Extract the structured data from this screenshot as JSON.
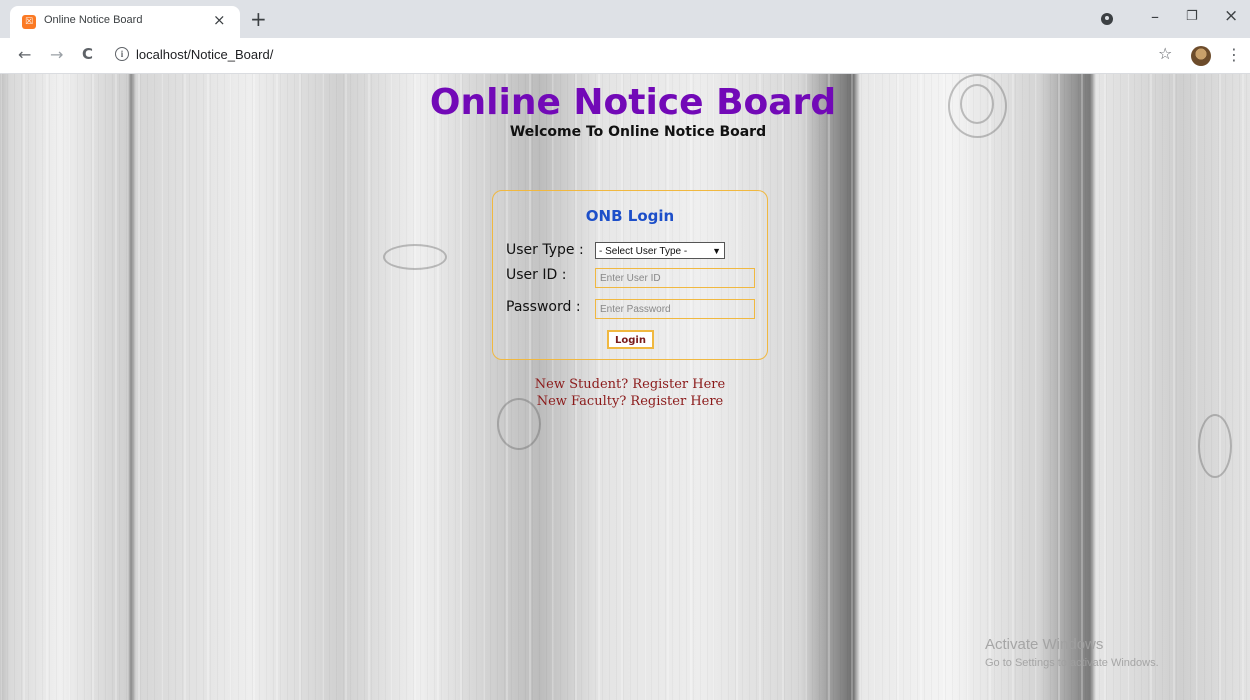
{
  "browser": {
    "tab_title": "Online Notice Board",
    "tab_close": "×",
    "new_tab": "+",
    "url": "localhost/Notice_Board/",
    "minimize": "–",
    "restore": "❐",
    "close": "×",
    "back": "←",
    "forward": "→",
    "reload": "C",
    "info": "i",
    "star": "☆",
    "menu": "⋮"
  },
  "page": {
    "title": "Online Notice Board",
    "subtitle": "Welcome To Online Notice Board"
  },
  "login": {
    "heading": "ONB Login",
    "user_type_label": "User Type :",
    "user_type_selected": "- Select User Type -",
    "user_id_label": "User ID :",
    "user_id_placeholder": "Enter User ID",
    "password_label": "Password :",
    "password_placeholder": "Enter Password",
    "button": "Login"
  },
  "links": {
    "student": "New Student? Register Here",
    "faculty": "New Faculty? Register Here"
  },
  "watermark": {
    "line1": "Activate Windows",
    "line2": "Go to Settings to activate Windows."
  },
  "colors": {
    "title": "#7209b7",
    "login_heading": "#1d4fc9",
    "accent_border": "#f0b840",
    "link": "#8b1a1a"
  },
  "icons": [
    "xampp-favicon-icon",
    "info-icon",
    "star-icon",
    "avatar-icon",
    "account-icon"
  ]
}
